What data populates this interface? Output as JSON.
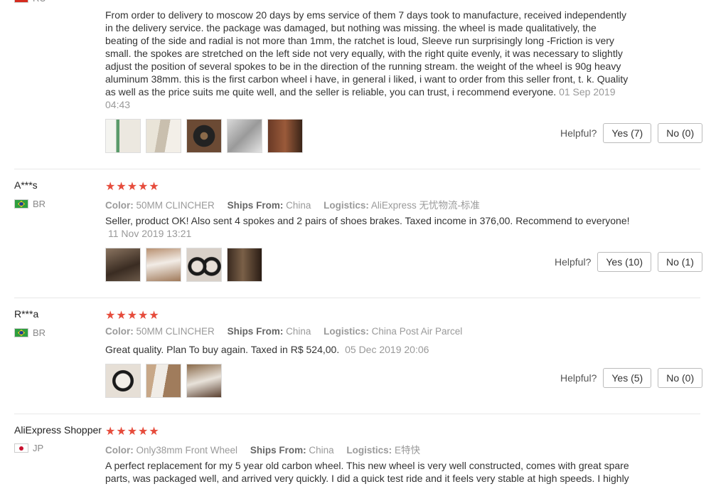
{
  "labels": {
    "color": "Color:",
    "ships_from": "Ships From:",
    "logistics": "Logistics:",
    "helpful": "Helpful?"
  },
  "reviews": [
    {
      "country": "RU",
      "text": "From order to delivery to moscow 20 days by ems service of them 7 days took to manufacture, received independently in the delivery service. the package was damaged, but nothing was missing. the wheel is made qualitatively, the beating of the side and radial is not more than 1mm, the ratchet is loud, Sleeve run surprisingly long -Friction is very small. the spokes are stretched on the left side not very equally, with the right quite evenly, it was necessary to slightly adjust the position of several spokes to be in the direction of the running stream. the weight of the wheel is 90g heavy aluminum 38mm. this is the first carbon wheel i have, in general i liked, i want to order from this seller front, t. k. Quality as well as the price suits me quite well, and the seller is reliable, you can trust, i recommend everyone.",
      "date": "01 Sep 2019 04:43",
      "yes": "Yes (7)",
      "no": "No (0)",
      "images": [
        "photo-box-green",
        "photo-wheel-bag",
        "photo-wheel-dark",
        "photo-spokes",
        "photo-hub-brown"
      ]
    },
    {
      "user": "A***s",
      "country": "BR",
      "stars": "★★★★★",
      "color": "50MM CLINCHER",
      "ships_from": "China",
      "logistics": "AliExpress 无忧物流-标准",
      "text": "Seller, product OK! Also sent 4 spokes and 2 pairs of shoes brakes. Taxed income in 376,00. Recommend to everyone!",
      "date": "11 Nov 2019 13:21",
      "yes": "Yes (10)",
      "no": "No (1)",
      "images": [
        "photo-box-brown",
        "photo-package-open",
        "photo-wheel-pair",
        "photo-wheel-room"
      ]
    },
    {
      "user": "R***a",
      "country": "BR",
      "stars": "★★★★★",
      "color": "50MM CLINCHER",
      "ships_from": "China",
      "logistics": "China Post Air Parcel",
      "text": "Great quality. Plan To buy again. Taxed in R$ 524,00.",
      "date": "05 Dec 2019 20:06",
      "yes": "Yes (5)",
      "no": "No (0)",
      "images": [
        "photo-wheel-single",
        "photo-wheel-wrapped",
        "photo-box-open"
      ]
    },
    {
      "user": "AliExpress Shopper",
      "country": "JP",
      "stars": "★★★★★",
      "color": "Only38mm Front Wheel",
      "ships_from": "China",
      "logistics": "E特快",
      "text": "A perfect replacement for my 5 year old carbon wheel. This new wheel is very well constructed, comes with great spare parts, was packaged well, and arrived very quickly. I did a quick test ride and it feels very stable at high speeds. I highly"
    }
  ],
  "colors": {
    "star": "#e64c3c",
    "meta_gray": "#9a9a9a",
    "text": "#333333"
  }
}
